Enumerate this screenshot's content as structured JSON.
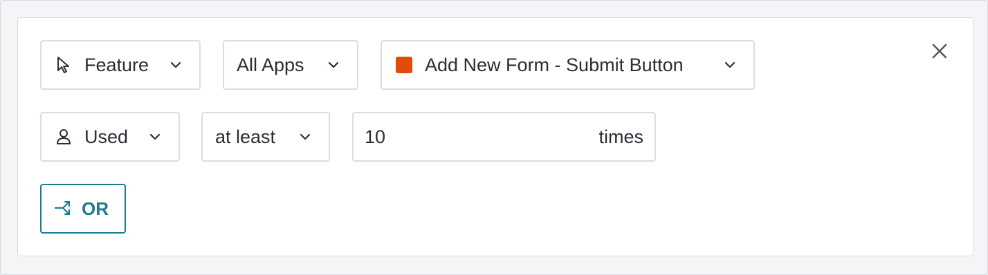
{
  "filter": {
    "event_type": {
      "label": "Feature",
      "icon": "cursor-icon"
    },
    "app_scope": {
      "label": "All Apps"
    },
    "target": {
      "label": "Add New Form - Submit Button",
      "color": "#e44a0b"
    },
    "action": {
      "label": "Used",
      "icon": "user-icon"
    },
    "comparator": {
      "label": "at least"
    },
    "count": {
      "value": "10",
      "suffix": "times"
    },
    "or_button": {
      "label": "OR",
      "icon": "branch-icon"
    },
    "close": {
      "icon": "close-icon"
    }
  },
  "colors": {
    "accent": "#1a7c8e",
    "swatch": "#e44a0b",
    "border": "#dadde3"
  }
}
